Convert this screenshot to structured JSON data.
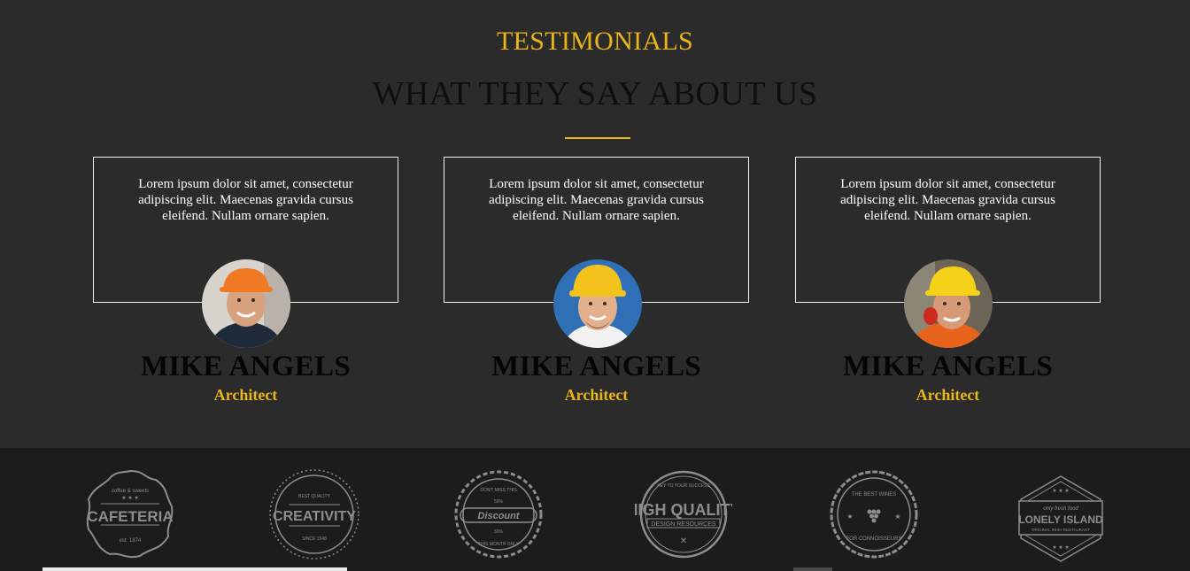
{
  "section": {
    "eyebrow": "TESTIMONIALS",
    "heading": "WHAT THEY SAY ABOUT US"
  },
  "testimonials": [
    {
      "quote": "Lorem ipsum dolor sit amet, consectetur adipiscing elit. Maecenas gravida cursus eleifend. Nullam ornare sapien.",
      "name": "MIKE ANGELS",
      "role": "Architect",
      "helmet_color": "#ef7a23"
    },
    {
      "quote": "Lorem ipsum dolor sit amet, consectetur adipiscing elit. Maecenas gravida cursus eleifend. Nullam ornare sapien.",
      "name": "MIKE ANGELS",
      "role": "Architect",
      "helmet_color": "#f3c21c"
    },
    {
      "quote": "Lorem ipsum dolor sit amet, consectetur adipiscing elit. Maecenas gravida cursus eleifend. Nullam ornare sapien.",
      "name": "MIKE ANGELS",
      "role": "Architect",
      "helmet_color": "#f5d21a"
    }
  ],
  "logos": [
    {
      "top": "coffee & sweets",
      "main": "CAFETERIA",
      "bottom": "est. 1874"
    },
    {
      "top": "BEST QUALITY",
      "main": "CREATIVITY",
      "bottom": "SINCE 1948"
    },
    {
      "top": "DON'T MISS THIS",
      "main": "Discount",
      "mid": "50%",
      "bottom": "THIS MONTH ONLY"
    },
    {
      "top": "KEY TO YOUR SUCCESS",
      "main": "HIGH QUALITY",
      "sub": "DESIGN RESOURCES"
    },
    {
      "top": "THE BEST WINES",
      "bottom": "FOR CONNOISSEURS"
    },
    {
      "top": "only fresh food",
      "main": "LONELY ISLAND",
      "sub": "ORIGINAL IRISH RESTAURANT"
    }
  ],
  "colors": {
    "accent": "#e8b51a",
    "background": "#2b2b2b",
    "footer": "#1c1c1c",
    "logo_gray": "#8d8d8d"
  }
}
